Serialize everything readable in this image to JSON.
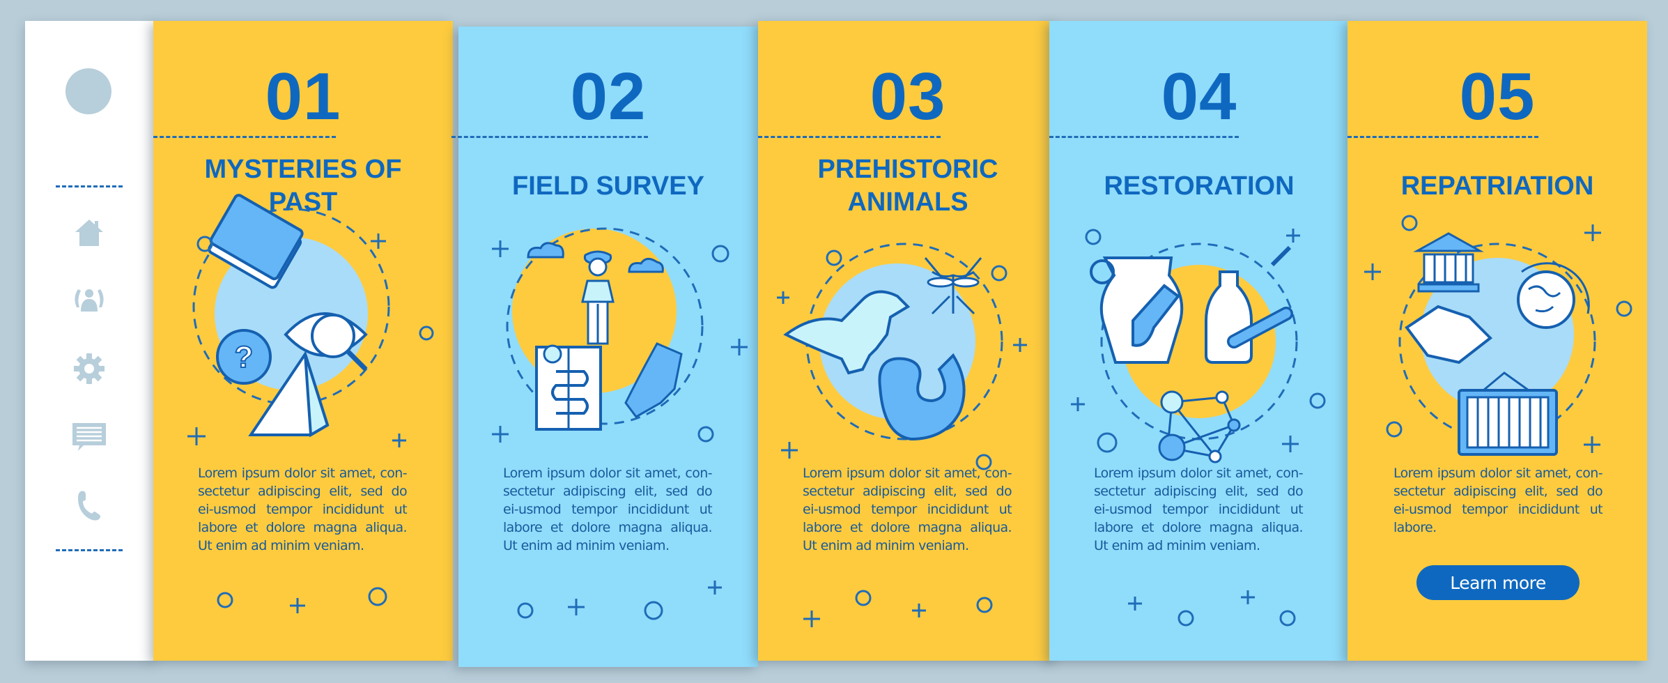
{
  "colors": {
    "background": "#b8cdd8",
    "sidebar": "#ffffff",
    "panel_yellow": "#fecb3e",
    "panel_blue": "#90dcfb",
    "accent_blue": "#0f68bf",
    "icon_gray": "#b7cedb"
  },
  "sidebar": {
    "avatar": "avatar-placeholder",
    "items": [
      {
        "icon": "home-icon",
        "label": "Home"
      },
      {
        "icon": "users-icon",
        "label": "Users"
      },
      {
        "icon": "gear-icon",
        "label": "Settings"
      },
      {
        "icon": "chat-icon",
        "label": "Messages"
      },
      {
        "icon": "phone-icon",
        "label": "Contact"
      }
    ]
  },
  "panels": [
    {
      "number": "01",
      "title_line1": "MYSTERIES OF",
      "title_line2": "PAST",
      "theme": "yellow",
      "illustration": "mysteries-illustration",
      "body": "Lorem ipsum dolor sit amet, con-sectetur adipiscing elit, sed do ei-usmod tempor incididunt ut labore et dolore magna aliqua. Ut enim ad minim veniam."
    },
    {
      "number": "02",
      "title_line1": "FIELD SURVEY",
      "theme": "blue",
      "illustration": "field-survey-illustration",
      "body": "Lorem ipsum dolor sit amet, con-sectetur adipiscing elit, sed do ei-usmod tempor incididunt ut labore et dolore magna aliqua. Ut enim ad minim veniam."
    },
    {
      "number": "03",
      "title_line1": "PREHISTORIC",
      "title_line2": "ANIMALS",
      "theme": "yellow",
      "illustration": "prehistoric-animals-illustration",
      "body": "Lorem ipsum dolor sit amet, con-sectetur adipiscing elit, sed do ei-usmod tempor incididunt ut labore et dolore magna aliqua. Ut enim ad minim veniam."
    },
    {
      "number": "04",
      "title_line1": "RESTORATION",
      "theme": "blue",
      "illustration": "restoration-illustration",
      "body": "Lorem ipsum dolor sit amet, con-sectetur adipiscing elit, sed do ei-usmod tempor incididunt ut labore et dolore magna aliqua. Ut enim ad minim veniam."
    },
    {
      "number": "05",
      "title_line1": "REPATRIATION",
      "theme": "yellow",
      "illustration": "repatriation-illustration",
      "body": "Lorem ipsum dolor sit amet, con-sectetur adipiscing elit, sed do ei-usmod tempor incididunt ut labore.",
      "button_label": "Learn more"
    }
  ]
}
